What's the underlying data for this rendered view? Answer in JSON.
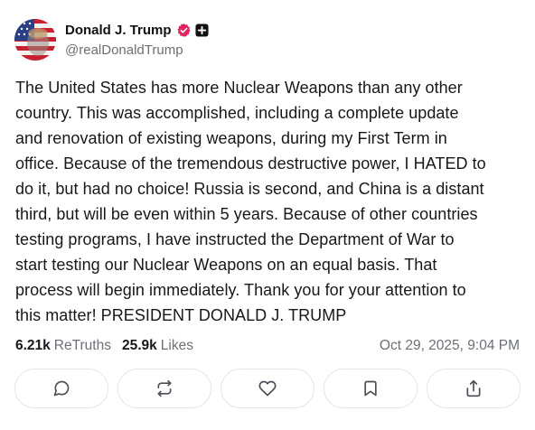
{
  "author": {
    "display_name": "Donald J. Trump",
    "handle": "@realDonaldTrump",
    "avatar_icon": "profile-photo-avatar",
    "verified_icon": "verified-badge-icon",
    "verified_color": "#e0245e",
    "extra_badge_icon": "plus-badge-icon"
  },
  "post": {
    "lines": [
      "The United States has more Nuclear Weapons than any other",
      "country. This was accomplished, including a complete update",
      "and renovation of existing weapons, during my First Term in",
      "office. Because of the tremendous destructive power, I HATED to",
      "do it, but had no choice! Russia is second, and China is a distant",
      "third, but will be even within 5 years. Because of other countries",
      "testing programs, I have instructed the Department of War to",
      "start testing our Nuclear Weapons on an equal basis. That",
      "process will begin immediately. Thank you for your attention to",
      "this matter! PRESIDENT DONALD J. TRUMP"
    ]
  },
  "stats": {
    "retruths_count": "6.21k",
    "retruths_label": "ReTruths",
    "likes_count": "25.9k",
    "likes_label": "Likes",
    "timestamp": "Oct 29, 2025, 9:04 PM"
  },
  "actions": [
    {
      "name": "reply",
      "icon": "speech-bubble-icon"
    },
    {
      "name": "retruth",
      "icon": "repost-arrows-icon"
    },
    {
      "name": "like",
      "icon": "heart-icon"
    },
    {
      "name": "bookmark",
      "icon": "bookmark-icon"
    },
    {
      "name": "share",
      "icon": "share-upload-icon"
    }
  ],
  "colors": {
    "text": "#16181c",
    "muted": "#6b6f76",
    "border": "#e3e4e8",
    "icon": "#4a4e56"
  }
}
